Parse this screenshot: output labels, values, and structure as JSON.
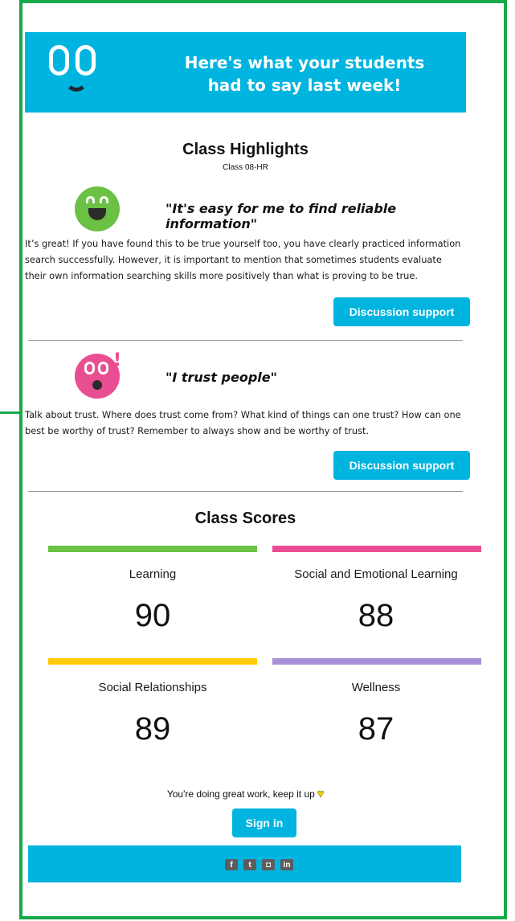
{
  "header": {
    "title_line1": "Here's what your students",
    "title_line2": "had to say last week!"
  },
  "highlights": {
    "title": "Class Highlights",
    "class_name": "Class 08-HR",
    "items": [
      {
        "quote": "\"It's easy for me to find reliable information\"",
        "text": "It’s great! If you have found this to be true yourself too, you have clearly practiced information search successfully. However, it is important to mention that sometimes students evaluate their own information searching skills more positively than what is proving to be true.",
        "button": "Discussion support",
        "face_color": "#6ac143"
      },
      {
        "quote": "\"I trust people\"",
        "text": "Talk about trust. Where does trust come from? What kind of things can one trust? How can one best be worthy of trust? Remember to always show and be worthy of trust.",
        "button": "Discussion support",
        "face_color": "#ea4e92"
      }
    ]
  },
  "scores": {
    "title": "Class Scores",
    "items": [
      {
        "label": "Learning",
        "value": "90",
        "color": "#6ac143"
      },
      {
        "label": "Social and Emotional Learning",
        "value": "88",
        "color": "#ea4e92"
      },
      {
        "label": "Social Relationships",
        "value": "89",
        "color": "#ffcb05"
      },
      {
        "label": "Wellness",
        "value": "87",
        "color": "#a98fd8"
      }
    ]
  },
  "footer": {
    "note": "You're doing great work, keep it up",
    "sign_in": "Sign in",
    "social_icons": [
      "facebook-icon",
      "twitter-icon",
      "instagram-icon",
      "linkedin-icon"
    ]
  },
  "colors": {
    "brand": "#00b4e0",
    "frame": "#19a84a"
  }
}
